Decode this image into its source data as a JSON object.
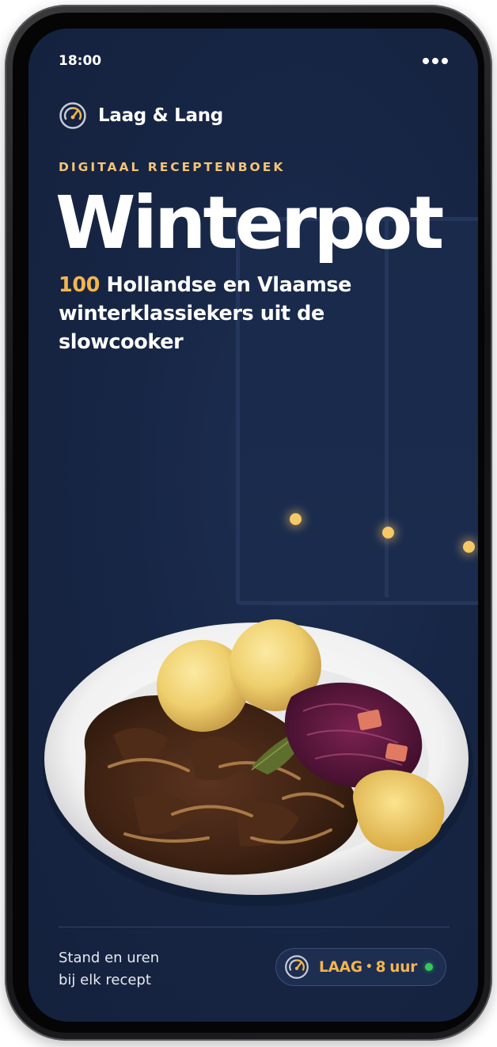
{
  "status_bar": {
    "time": "18:00",
    "menu_icon": "more-dots-icon"
  },
  "brand": {
    "icon": "gauge-icon",
    "name": "Laag & Lang"
  },
  "hero": {
    "kicker": "DIGITAAL RECEPTENBOEK",
    "title": "Winterpot",
    "subtitle_number": "100",
    "subtitle_rest": " Hollandse en Vlaamse winterklassiekers uit de slowcooker"
  },
  "footer": {
    "line1": "Stand en uren",
    "line2": "bij elk recept",
    "badge": {
      "icon": "gauge-icon",
      "level": "LAAG",
      "separator": "•",
      "hours": "8",
      "unit": "uur",
      "status_color": "#35c759"
    }
  },
  "colors": {
    "background": "#172645",
    "accent": "#f3b54f",
    "kicker": "#f4c478"
  }
}
